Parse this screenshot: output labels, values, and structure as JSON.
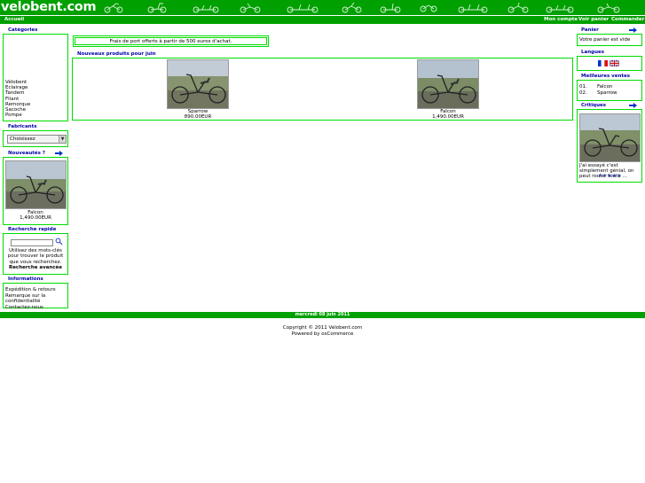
{
  "header": {
    "logo": "velobent.com",
    "nav_home": "Accueil",
    "nav_account": "Mon compte",
    "nav_cart": "Voir panier",
    "nav_checkout": "Commander"
  },
  "left": {
    "categories": {
      "title": "Catégories",
      "items": [
        "Vélobent",
        "Eclairage",
        "Tandem",
        "Fliant",
        "Remorque",
        "Sacoche",
        "Pompe"
      ]
    },
    "manufacturers": {
      "title": "Fabricants",
      "select_value": "Choisissez"
    },
    "whats_new": {
      "title": "Nouveautés ?",
      "product_name": "Falcon",
      "product_price": "1,490.00EUR"
    },
    "quick_search": {
      "title": "Recherche rapide",
      "help": "Utilisez des mots-clés pour trouver le produit que vous recherchez.",
      "advanced": "Recherche avancée"
    },
    "information": {
      "title": "Informations",
      "items": [
        "Expédition & retours",
        "Remarque sur la confidentialité",
        "Contactez-nous"
      ]
    }
  },
  "center": {
    "shipping_notice": "Frais de port offerts à partir de 500 euros d'achat.",
    "new_products": {
      "title": "Nouveaux produits pour juin",
      "items": [
        {
          "name": "Sparrow",
          "price": "890.00EUR"
        },
        {
          "name": "Falcon",
          "price": "1,490.00EUR"
        }
      ]
    }
  },
  "right": {
    "cart": {
      "title": "Panier",
      "empty": "Votre panier est vide"
    },
    "languages": {
      "title": "Langues"
    },
    "bestsellers": {
      "title": "Meilleures ventes",
      "items": [
        {
          "rank": "01.",
          "name": "Falcon"
        },
        {
          "rank": "02.",
          "name": "Sparrow"
        }
      ]
    },
    "reviews": {
      "title": "Critiques",
      "text": "J'ai essayé c'est simplement génial, on peut rouler toute ...",
      "stars": "★★★★★"
    }
  },
  "footer": {
    "date": "mercredi 08 juin 2011",
    "copyright": "Copyright © 2011 Velobent.com",
    "powered": "Powered by osCommerce"
  },
  "colors": {
    "header_green": "#00a000",
    "box_border": "#00dd00",
    "title_blue": "#0000aa"
  }
}
